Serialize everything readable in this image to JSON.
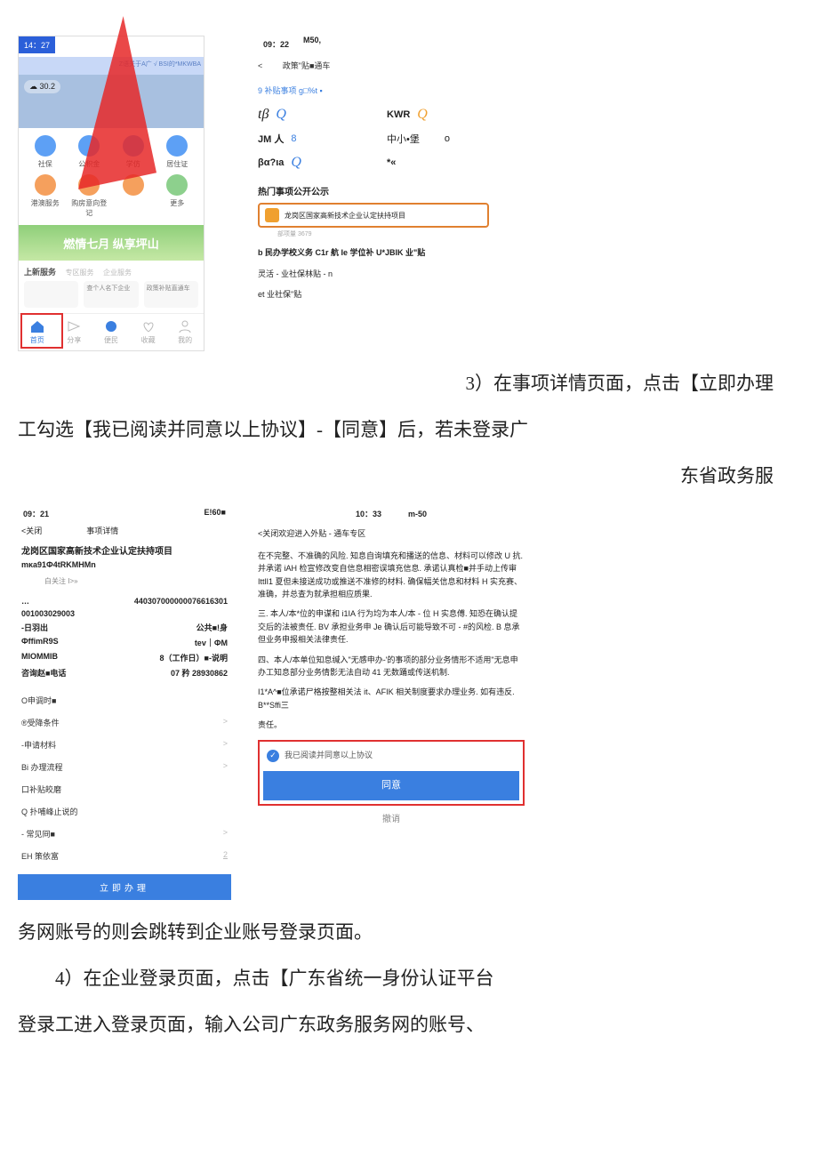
{
  "row1": {
    "left": {
      "time_badge": "14：27",
      "blue_bar": "Z语关于A广 √ BSI的*MKWBA",
      "weather": "30.2",
      "icons": [
        "社保",
        "公积金",
        "学仿",
        "居住证",
        "港澳服务",
        "购房意向登记",
        "",
        "更多"
      ],
      "banner": "燃情七月 纵享坪山",
      "new_svc_title": "上新服务",
      "new_svc_tabs": [
        "专区服务",
        "企业服务"
      ],
      "svc_cards": [
        "",
        "查个人名下企业",
        "政策补贴直通车"
      ],
      "nav": [
        "首页",
        "分享",
        "便民",
        "收藏",
        "我的"
      ]
    },
    "right": {
      "time": "09：22",
      "batt": "M50,",
      "back": "<",
      "title": "政策\"贴■通车",
      "sub_count": "9 补贴事项 g□%t ▪",
      "cats": [
        {
          "l": "tβ",
          "lq": "Q",
          "r": "KWR",
          "rq": "Q"
        },
        {
          "l": "JM 人",
          "lq": "8",
          "r": "中小•堡",
          "rq": "o"
        },
        {
          "l": "βα?ιa",
          "lq": "Q",
          "r": "*«",
          "rq": ""
        }
      ],
      "hot_title": "热门事项公开公示",
      "hot_card": "龙岗区国家高新技术企业认定扶持项目",
      "hot_sub": "部项量 3679",
      "line_b": "b 民办学校义务 C1r 航 Ie 学位补 U*JBIK 业\"贴",
      "line_c": "灵活 - 业社保林贴 - n",
      "line_d": "et 业社保\"贴"
    }
  },
  "para1_a": "3）在事项详情页面，点击【立即办理",
  "para1_b": "工勾选【我已阅读并同意以上协议】-【同意】后，若未登录广",
  "para1_c": "东省政务服",
  "row2": {
    "left": {
      "time": "09：21",
      "batt": "E!60■",
      "back": "<关闭",
      "title": "事项详情",
      "proj": "龙岗区国家高新技术企业认定扶持项目",
      "code": "mκa91Ф4tRKMHMn",
      "fav": "白关注          I>»",
      "info": [
        {
          "l": "…",
          "r": "440307000000076616301"
        },
        {
          "l": "001003029003",
          "r": ""
        },
        {
          "l": "-日羽出",
          "r": "公共■!身"
        },
        {
          "l": "ФffimR9S",
          "r": "tev｜ФM"
        },
        {
          "l": "MIOMMIB",
          "r": "8（工作日）■-说明"
        },
        {
          "l": "咨询赵■电话",
          "r": "07 矜 28930862"
        }
      ],
      "menu": [
        {
          "t": "O申调时■",
          "c": ""
        },
        {
          "t": "®受降条件",
          "c": ">"
        },
        {
          "t": "-申请材料",
          "c": ">"
        },
        {
          "t": "Bi 办理流程",
          "c": ">"
        },
        {
          "t": "口补贴皎磨",
          "c": ""
        },
        {
          "t": "Q 扑哺峰止说的",
          "c": ""
        },
        {
          "t": "- 常见冏■",
          "c": ">"
        },
        {
          "t": "EH 策依富",
          "c": "2"
        }
      ],
      "action": "立即办理"
    },
    "right": {
      "time": "10：33",
      "batt": "m-50",
      "hdr": "<关闭欢迎进入外贴 - 通车专区",
      "p1": "在不完整、不准确的风险. 知息自询填充和播送的信息、材料可以修改 U 抗. 并承诺 iAH 检宣修改变自信息相密误填充信息. 承诺认真检■并手动上传审 IttlI1 夏但未接送成功或推送不准修的材料. 确保幅关信息和材料 H 实充赛、准确，并总查为就承担相应质果.",
      "p2": "三. 本人/本*位的申谋和 i1IA 行为均为本人/本 - 位 H 实息傅. 知恐在确认提交后的法被责任. BV 承担业务申 Je 确认后可能导致不可 - #的风检. B 息承但业务申报相关法律责任.",
      "p3": "四、本人/本单位知息缄入\"无感申办-'的事项的部分业务情形不适用\"无息申办工知息部分业务情影无法自动 41 无数踊或传送机制.",
      "p4": "I1*A^■位承诺尸格按整相关法 it、AFIK 相关制度要求办理业务. 如有违反. B**Sffi三",
      "p5": "责任。",
      "check": "我已阅读并同意以上协议",
      "agree": "同意",
      "cancel": "撤诮"
    }
  },
  "para2": "务网账号的则会跳转到企业账号登录页面。",
  "para3": "4）在企业登录页面，点击【广东省统一身份认证平台",
  "para4": "登录工进入登录页面，输入公司广东政务服务网的账号、"
}
